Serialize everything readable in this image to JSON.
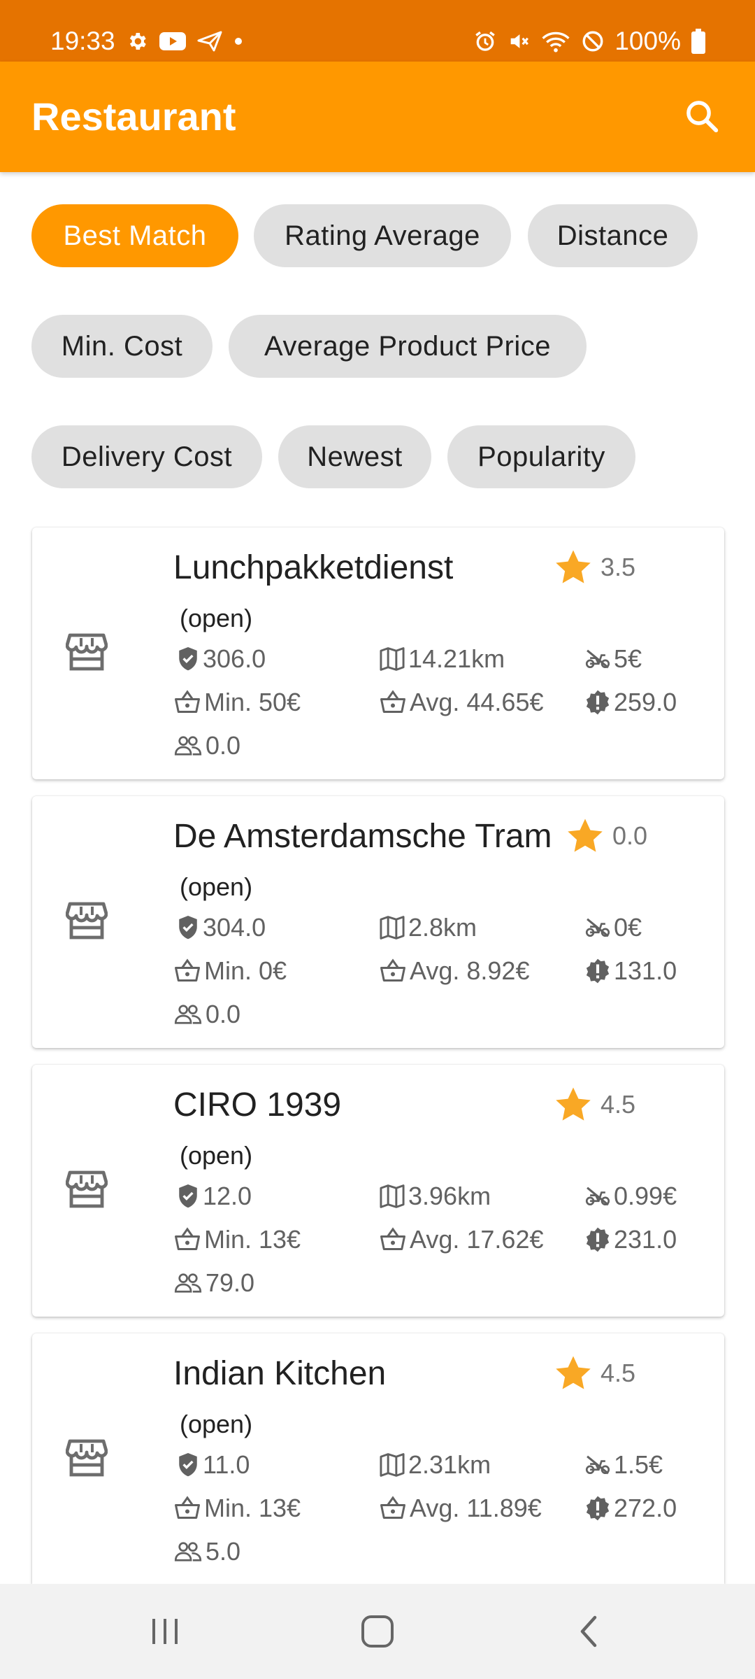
{
  "status_bar": {
    "time": "19:33",
    "battery": "100%",
    "left_icons": [
      "settings-icon",
      "youtube-icon",
      "send-icon",
      "dot-icon"
    ],
    "right_icons": [
      "alarm-icon",
      "mute-icon",
      "wifi-icon",
      "dnd-icon",
      "battery-icon"
    ]
  },
  "app_bar": {
    "title": "Restaurant",
    "search_icon": "search-icon"
  },
  "filters": [
    {
      "label": "Best Match",
      "selected": true
    },
    {
      "label": "Rating Average",
      "selected": false
    },
    {
      "label": "Distance",
      "selected": false
    },
    {
      "label": "Min. Cost",
      "selected": false
    },
    {
      "label": "Average Product Price",
      "selected": false
    },
    {
      "label": "Delivery Cost",
      "selected": false
    },
    {
      "label": "Newest",
      "selected": false
    },
    {
      "label": "Popularity",
      "selected": false
    }
  ],
  "restaurants": [
    {
      "name": "Lunchpakketdienst",
      "rating": "3.5",
      "status": "(open)",
      "score": "306.0",
      "distance": "14.21km",
      "delivery_cost": "5€",
      "min_cost": "Min. 50€",
      "avg_price": "Avg. 44.65€",
      "alert_value": "259.0",
      "popularity": "0.0"
    },
    {
      "name": "De Amsterdamsche Tram",
      "rating": "0.0",
      "status": "(open)",
      "score": "304.0",
      "distance": "2.8km",
      "delivery_cost": "0€",
      "min_cost": "Min. 0€",
      "avg_price": "Avg. 8.92€",
      "alert_value": "131.0",
      "popularity": "0.0"
    },
    {
      "name": "CIRO 1939",
      "rating": "4.5",
      "status": "(open)",
      "score": "12.0",
      "distance": "3.96km",
      "delivery_cost": "0.99€",
      "min_cost": "Min. 13€",
      "avg_price": "Avg. 17.62€",
      "alert_value": "231.0",
      "popularity": "79.0"
    },
    {
      "name": "Indian Kitchen",
      "rating": "4.5",
      "status": "(open)",
      "score": "11.0",
      "distance": "2.31km",
      "delivery_cost": "1.5€",
      "min_cost": "Min. 13€",
      "avg_price": "Avg. 11.89€",
      "alert_value": "272.0",
      "popularity": "5.0"
    }
  ],
  "colors": {
    "status_bar": "#e57300",
    "app_bar": "#ff9800",
    "chip_selected": "#ff9800",
    "chip": "#e0e0e0",
    "star": "#f9a825"
  },
  "nav_bar": {
    "icons": [
      "recent-apps-icon",
      "home-icon",
      "back-icon"
    ]
  }
}
